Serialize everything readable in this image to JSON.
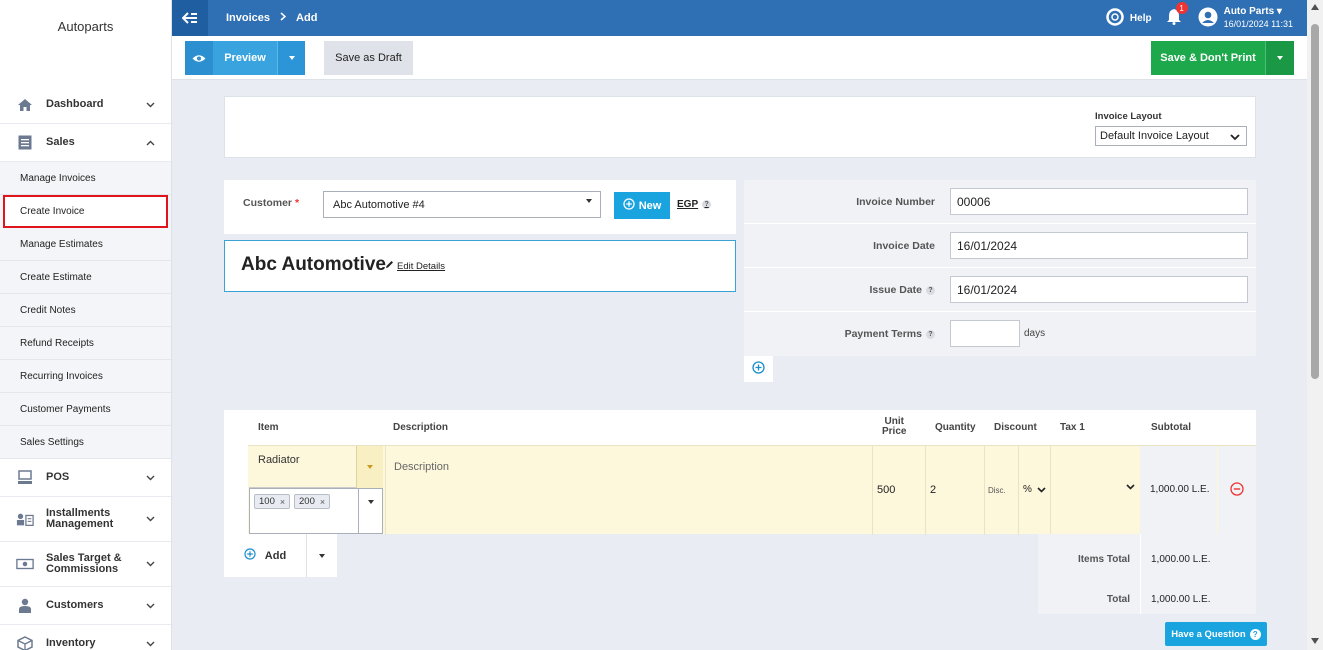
{
  "sidebar": {
    "brand": "Autoparts",
    "items": [
      {
        "label": "Dashboard",
        "icon": "home-icon"
      },
      {
        "label": "Sales",
        "icon": "list-icon"
      }
    ],
    "sales_submenu": [
      "Manage Invoices",
      "Create Invoice",
      "Manage Estimates",
      "Create Estimate",
      "Credit Notes",
      "Refund Receipts",
      "Recurring Invoices",
      "Customer Payments",
      "Sales Settings"
    ],
    "active_submenu": "Create Invoice",
    "items_after": [
      {
        "label": "POS",
        "icon": "monitor-icon"
      },
      {
        "label": "Installments Management",
        "icon": "installments-icon"
      },
      {
        "label": "Sales Target & Commissions",
        "icon": "money-icon"
      },
      {
        "label": "Customers",
        "icon": "customer-icon"
      },
      {
        "label": "Inventory",
        "icon": "box-icon"
      }
    ]
  },
  "topbar": {
    "breadcrumb": [
      "Invoices",
      "Add"
    ],
    "help_label": "Help",
    "notification_count": "1",
    "user_name": "Auto Parts",
    "user_datetime": "16/01/2024 11:31"
  },
  "actions": {
    "preview_label": "Preview",
    "draft_label": "Save as Draft",
    "save_label": "Save & Don't Print"
  },
  "layout": {
    "label": "Invoice Layout",
    "selected": "Default Invoice Layout"
  },
  "customer": {
    "label": "Customer",
    "required_mark": "*",
    "selected": "Abc Automotive #4",
    "new_label": "New",
    "currency": "EGP",
    "client_name": "Abc Automotive",
    "edit_label": "Edit Details"
  },
  "details": {
    "invoice_number_label": "Invoice Number",
    "invoice_number": "00006",
    "invoice_date_label": "Invoice Date",
    "invoice_date": "16/01/2024",
    "issue_date_label": "Issue Date",
    "issue_date": "16/01/2024",
    "payment_terms_label": "Payment Terms",
    "payment_terms": "",
    "days_label": "days"
  },
  "table": {
    "headers": {
      "item": "Item",
      "description": "Description",
      "unit_price_1": "Unit",
      "unit_price_2": "Price",
      "quantity": "Quantity",
      "discount": "Discount",
      "tax": "Tax 1",
      "subtotal": "Subtotal"
    },
    "row": {
      "item": "Radiator",
      "tags": [
        "100",
        "200"
      ],
      "description_placeholder": "Description",
      "unit_price": "500",
      "quantity": "2",
      "discount_label": "Disc.",
      "discount_type": "%",
      "subtotal": "1,000.00 L.E."
    },
    "add_label": "Add"
  },
  "totals": {
    "items_total_label": "Items Total",
    "items_total": "1,000.00 L.E.",
    "total_label": "Total",
    "total": "1,000.00 L.E."
  },
  "help_widget": {
    "label": "Have a Question"
  },
  "colors": {
    "topbar": "#2f6fb3",
    "primary": "#39a3e0",
    "success": "#1da84c",
    "highlight": "#e0141c"
  }
}
